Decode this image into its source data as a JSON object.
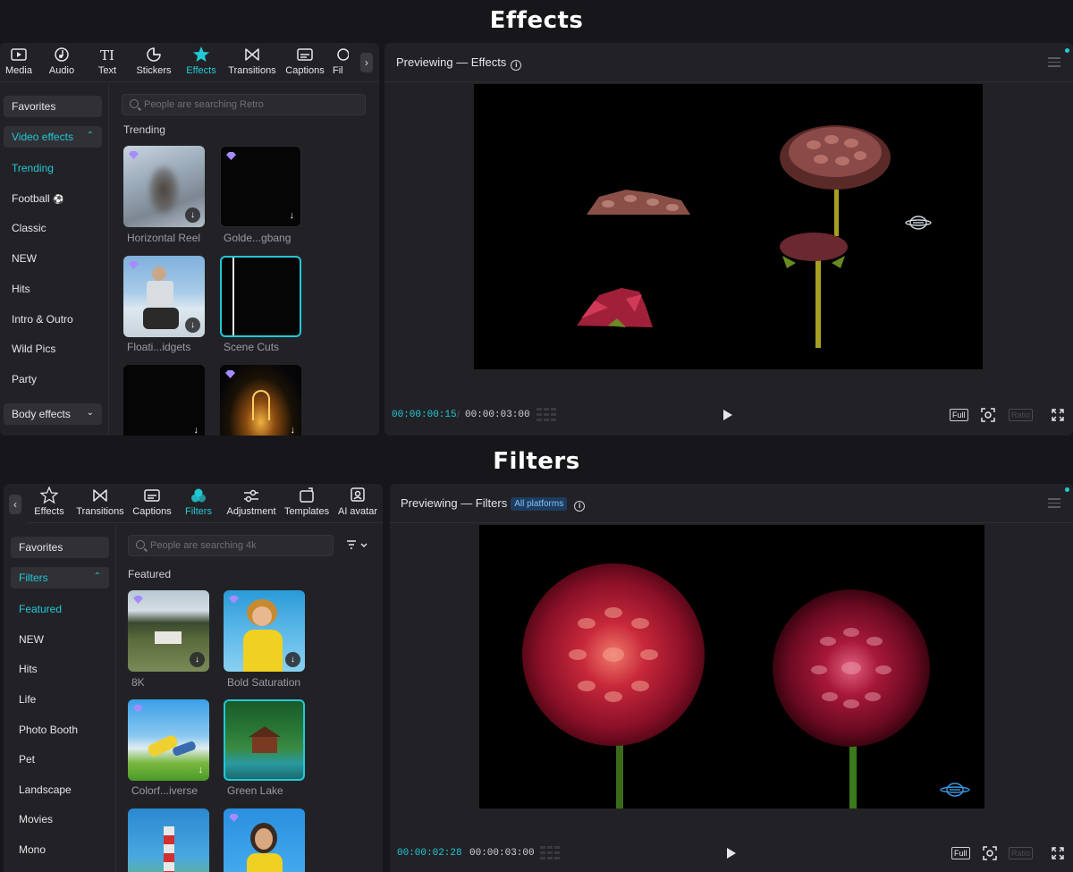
{
  "effects_section": {
    "title": "Effects",
    "toolbar": [
      {
        "label": "Media",
        "icon": "media-icon"
      },
      {
        "label": "Audio",
        "icon": "audio-icon"
      },
      {
        "label": "Text",
        "icon": "text-icon"
      },
      {
        "label": "Stickers",
        "icon": "stickers-icon"
      },
      {
        "label": "Effects",
        "icon": "effects-icon",
        "active": true
      },
      {
        "label": "Transitions",
        "icon": "transitions-icon"
      },
      {
        "label": "Captions",
        "icon": "captions-icon"
      },
      {
        "label": "Fil",
        "icon": "filters-icon"
      }
    ],
    "sidebar": {
      "favorites": "Favorites",
      "video_effects": "Video effects",
      "items": [
        "Trending",
        "Football",
        "Classic",
        "NEW",
        "Hits",
        "Intro & Outro",
        "Wild Pics",
        "Party"
      ],
      "football_emoji": "⚽",
      "body_effects": "Body effects"
    },
    "search_placeholder": "People are searching Retro",
    "group_label": "Trending",
    "items": [
      {
        "label": "Horizontal Reel"
      },
      {
        "label": "Golde...gbang"
      },
      {
        "label": "Floati...idgets"
      },
      {
        "label": "Scene Cuts"
      }
    ],
    "preview": {
      "title": "Previewing — Effects",
      "time_current": "00:00:00:15",
      "time_total": "00:00:03:00",
      "full_label": "Full",
      "ratio_label": "Ratio"
    }
  },
  "filters_section": {
    "title": "Filters",
    "toolbar": [
      {
        "label": "Effects",
        "icon": "effects-icon"
      },
      {
        "label": "Transitions",
        "icon": "transitions-icon"
      },
      {
        "label": "Captions",
        "icon": "captions-icon"
      },
      {
        "label": "Filters",
        "icon": "filters-icon",
        "active": true
      },
      {
        "label": "Adjustment",
        "icon": "adjustment-icon"
      },
      {
        "label": "Templates",
        "icon": "templates-icon"
      },
      {
        "label": "AI avatar",
        "icon": "ai-avatar-icon"
      }
    ],
    "sidebar": {
      "favorites": "Favorites",
      "filters": "Filters",
      "items": [
        "Featured",
        "NEW",
        "Hits",
        "Life",
        "Photo Booth",
        "Pet",
        "Landscape",
        "Movies",
        "Mono"
      ]
    },
    "search_placeholder": "People are searching 4k",
    "group_label": "Featured",
    "items": [
      {
        "label": "8K"
      },
      {
        "label": "Bold Saturation"
      },
      {
        "label": "Colorf...iverse"
      },
      {
        "label": "Green Lake"
      }
    ],
    "preview": {
      "title": "Previewing — Filters",
      "badge": "All platforms",
      "time_current": "00:00:02:28",
      "time_total": "00:00:03:00",
      "full_label": "Full",
      "ratio_label": "Ratio"
    }
  },
  "colors": {
    "accent": "#22c8d6",
    "panel": "#222226",
    "background": "#17171b"
  }
}
